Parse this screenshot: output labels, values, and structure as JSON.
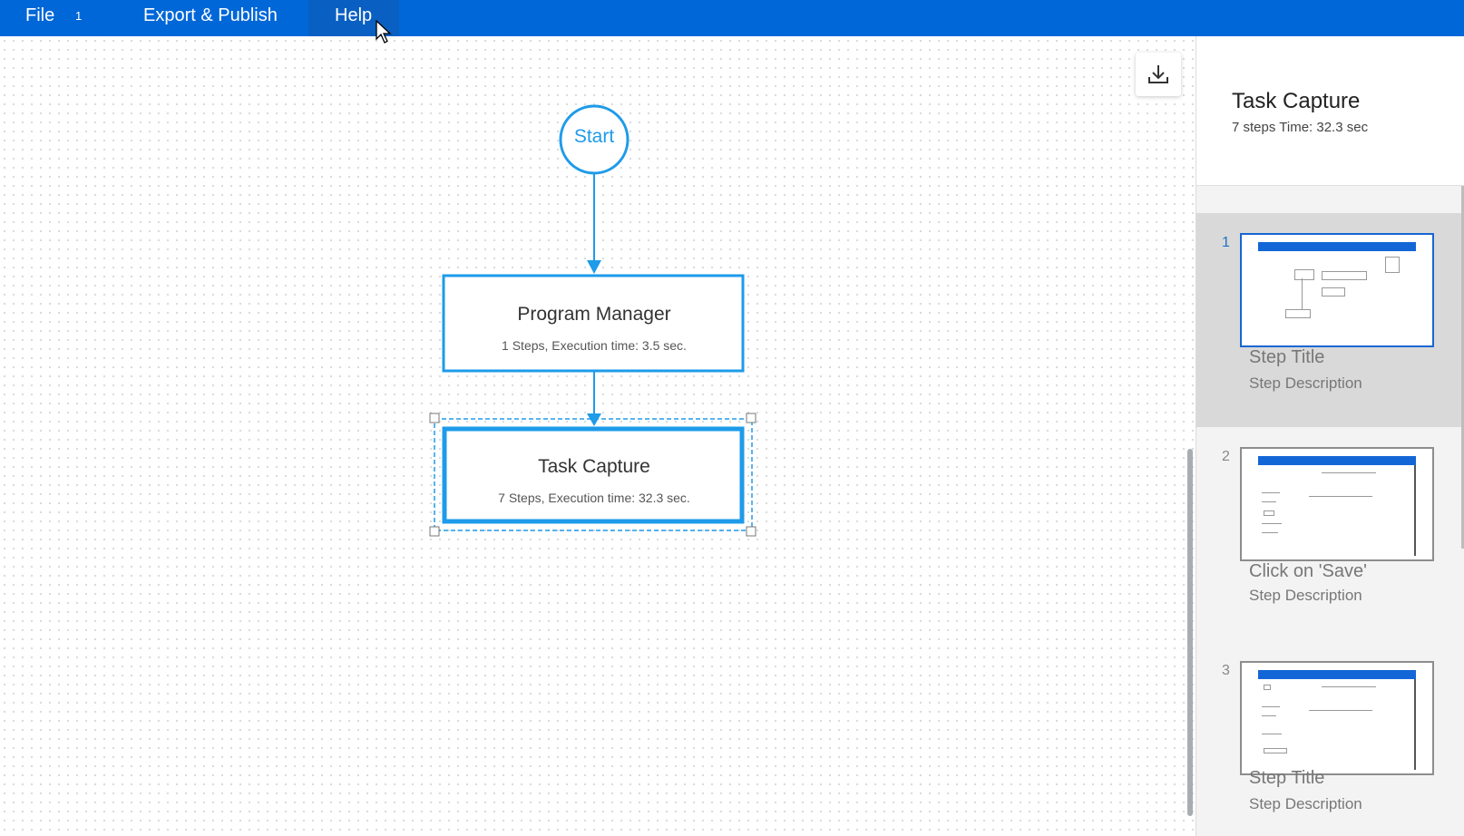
{
  "menubar": {
    "file_label": "File",
    "file_badge": "1",
    "export_label": "Export & Publish",
    "help_label": "Help",
    "background_color": "#0067d8"
  },
  "flowchart": {
    "start_label": "Start",
    "nodes": [
      {
        "title": "Program Manager",
        "subtitle": "1 Steps, Execution time: 3.5 sec."
      },
      {
        "title": "Task Capture",
        "subtitle": "7 Steps, Execution time: 32.3 sec."
      }
    ],
    "accent_color": "#1e9be9"
  },
  "toolbar": {
    "download_icon": "download-icon"
  },
  "panel": {
    "title": "Task Capture",
    "subtitle": "7 steps Time: 32.3 sec",
    "steps": [
      {
        "number": "1",
        "title": "Step Title",
        "description": "Step Description"
      },
      {
        "number": "2",
        "title": "Click on 'Save'",
        "description": "Step Description"
      },
      {
        "number": "3",
        "title": "Step Title",
        "description": "Step Description"
      }
    ]
  }
}
